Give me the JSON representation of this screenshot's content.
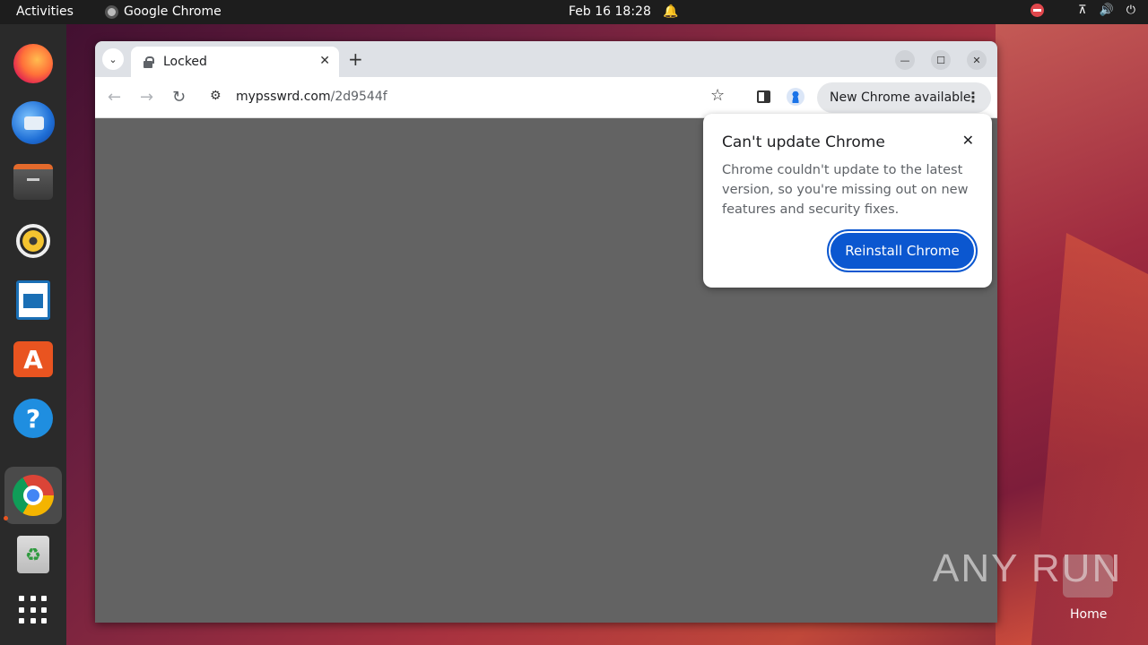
{
  "topbar": {
    "activities": "Activities",
    "app_name": "Google Chrome",
    "clock": "Feb 16  18:28"
  },
  "dock": {
    "items": [
      "firefox",
      "thunderbird",
      "files",
      "rhythmbox",
      "libreoffice-writer",
      "app-center",
      "help",
      "google-chrome",
      "trash",
      "show-apps"
    ]
  },
  "browser": {
    "tab_title": "Locked",
    "url_host": "mypsswrd.com",
    "url_path": "/2d9544f",
    "update_chip": "New Chrome available"
  },
  "popup": {
    "title": "Can't update Chrome",
    "body": "Chrome couldn't update to the latest version, so you're missing out on new features and security fixes.",
    "button": "Reinstall Chrome"
  },
  "desktop": {
    "watermark": "ANY RUN",
    "home_label": "Home"
  },
  "colors": {
    "accent_button": "#0b57d0",
    "content_bg": "#636363"
  }
}
